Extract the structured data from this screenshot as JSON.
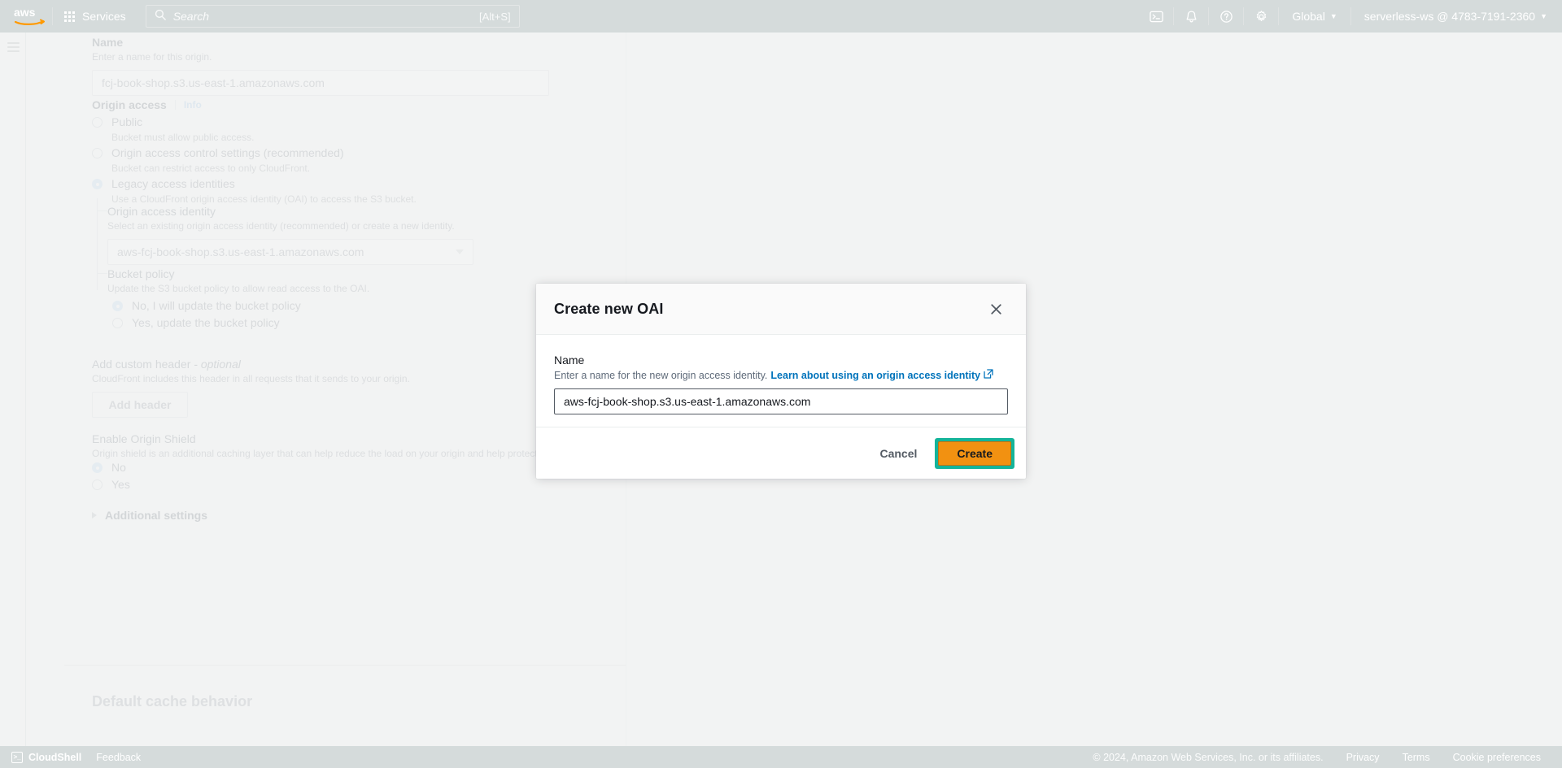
{
  "topnav": {
    "logo_alt": "aws",
    "services_label": "Services",
    "search_placeholder": "Search",
    "search_shortcut": "[Alt+S]",
    "region_label": "Global",
    "account_label": "serverless-ws @ 4783-7191-2360",
    "icons": [
      "cloudshell-icon",
      "bell-icon",
      "help-icon",
      "settings-icon"
    ]
  },
  "background_form": {
    "name_label": "Name",
    "name_desc": "Enter a name for this origin.",
    "name_value": "fcj-book-shop.s3.us-east-1.amazonaws.com",
    "origin_access_label": "Origin access",
    "origin_access_info": "Info",
    "options": [
      {
        "label": "Public",
        "desc": "Bucket must allow public access.",
        "selected": false
      },
      {
        "label": "Origin access control settings (recommended)",
        "desc": "Bucket can restrict access to only CloudFront.",
        "selected": false
      },
      {
        "label": "Legacy access identities",
        "desc": "Use a CloudFront origin access identity (OAI) to access the S3 bucket.",
        "selected": true
      }
    ],
    "oai_label": "Origin access identity",
    "oai_desc": "Select an existing origin access identity (recommended) or create a new identity.",
    "oai_selected": "aws-fcj-book-shop.s3.us-east-1.amazonaws.com",
    "bucket_policy_label": "Bucket policy",
    "bucket_policy_desc": "Update the S3 bucket policy to allow read access to the OAI.",
    "bucket_policy_options": [
      {
        "label": "No, I will update the bucket policy",
        "selected": true
      },
      {
        "label": "Yes, update the bucket policy",
        "selected": false
      }
    ],
    "custom_header_label": "Add custom header",
    "custom_header_optional": "- optional",
    "custom_header_desc": "CloudFront includes this header in all requests that it sends to your origin.",
    "add_header_button": "Add header",
    "origin_shield_label": "Enable Origin Shield",
    "origin_shield_desc": "Origin shield is an additional caching layer that can help reduce the load on your origin and help protect its availability.",
    "origin_shield_options": [
      {
        "label": "No",
        "selected": true
      },
      {
        "label": "Yes",
        "selected": false
      }
    ],
    "additional_settings_label": "Additional settings",
    "default_cache_behavior_label": "Default cache behavior"
  },
  "modal": {
    "title": "Create new OAI",
    "close_icon": "close-icon",
    "name_label": "Name",
    "name_desc": "Enter a name for the new origin access identity.",
    "learn_link": "Learn about using an origin access identity",
    "name_value": "aws-fcj-book-shop.s3.us-east-1.amazonaws.com",
    "cancel_label": "Cancel",
    "create_label": "Create",
    "highlight_color": "#14b49a",
    "create_bg": "#f29111"
  },
  "footer": {
    "cloudshell": "CloudShell",
    "feedback": "Feedback",
    "copyright": "© 2024, Amazon Web Services, Inc. or its affiliates.",
    "privacy": "Privacy",
    "terms": "Terms",
    "cookie_preferences": "Cookie preferences"
  }
}
